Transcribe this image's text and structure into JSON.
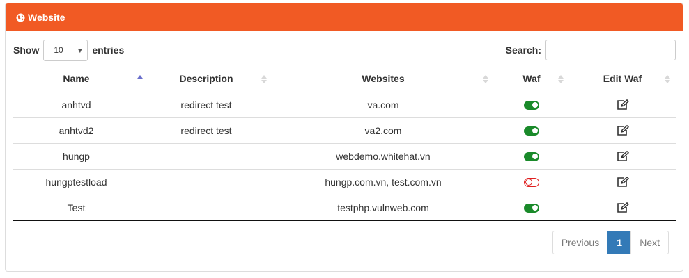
{
  "panel": {
    "title": "Website",
    "header_color": "#f15a24"
  },
  "length": {
    "show_label": "Show",
    "value": "10",
    "entries_label": "entries"
  },
  "search": {
    "label": "Search:",
    "value": ""
  },
  "table": {
    "columns": [
      "Name",
      "Description",
      "Websites",
      "Waf",
      "Edit Waf"
    ],
    "rows": [
      {
        "name": "anhtvd",
        "description": "redirect test",
        "websites": "va.com",
        "waf": "on"
      },
      {
        "name": "anhtvd2",
        "description": "redirect test",
        "websites": "va2.com",
        "waf": "on"
      },
      {
        "name": "hungp",
        "description": "",
        "websites": "webdemo.whitehat.vn",
        "waf": "on"
      },
      {
        "name": "hungptestload",
        "description": "",
        "websites": "hungp.com.vn, test.com.vn",
        "waf": "off"
      },
      {
        "name": "Test",
        "description": "",
        "websites": "testphp.vulnweb.com",
        "waf": "on"
      }
    ],
    "edit_icon": "edit-icon"
  },
  "pagination": {
    "previous": "Previous",
    "current": "1",
    "next": "Next",
    "active_color": "#337ab7"
  }
}
